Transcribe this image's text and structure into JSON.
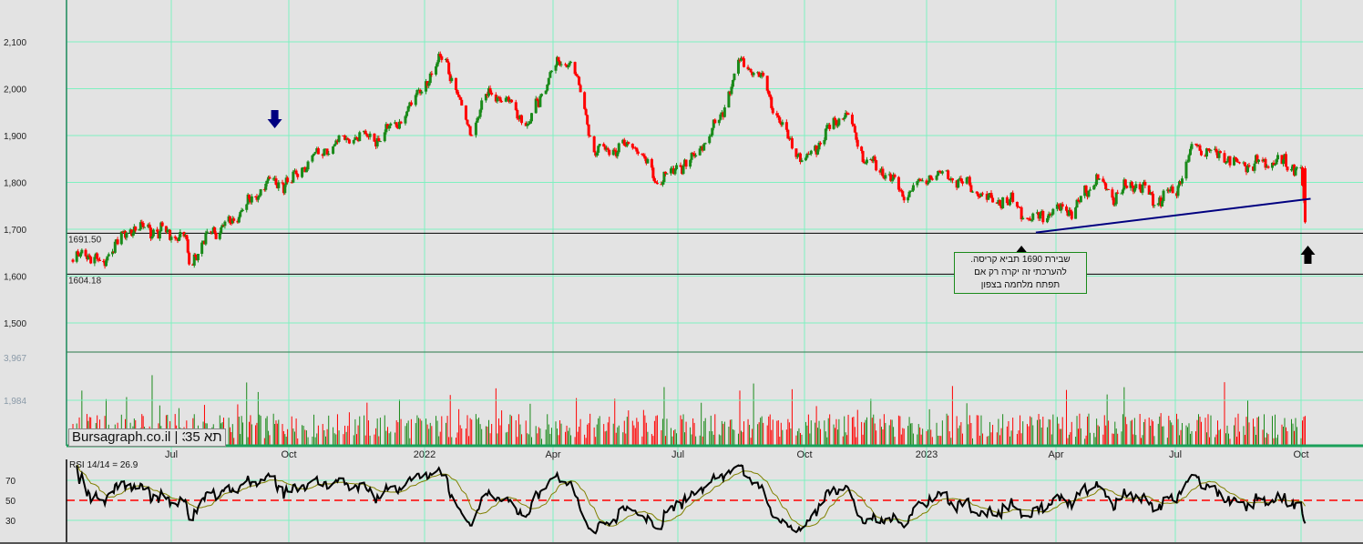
{
  "chart_data": {
    "type": "candlestick",
    "instrument": "תא 35",
    "watermark": "Bursagraph.co.il | 35 תא",
    "y_ticks": [
      "2,100",
      "2,000",
      "1,900",
      "1,800",
      "1,700",
      "1,600",
      "1,500"
    ],
    "y_tick_values": [
      2100,
      2000,
      1900,
      1800,
      1700,
      1600,
      1500
    ],
    "ylim": [
      1430,
      2190
    ],
    "x_ticks": [
      {
        "label": "Jul",
        "date": "2021-07-01"
      },
      {
        "label": "Oct",
        "date": "2021-10-01"
      },
      {
        "label": "2022",
        "date": "2022-01-01"
      },
      {
        "label": "Apr",
        "date": "2022-04-01"
      },
      {
        "label": "Jul",
        "date": "2022-07-01"
      },
      {
        "label": "Oct",
        "date": "2022-10-01"
      },
      {
        "label": "2023",
        "date": "2023-01-01"
      },
      {
        "label": "Apr",
        "date": "2023-04-01"
      },
      {
        "label": "Jul",
        "date": "2023-07-01"
      },
      {
        "label": "Oct",
        "date": "2023-10-01"
      }
    ],
    "grid": true,
    "colors": {
      "up": "#1a8a1a",
      "down": "#ff0000",
      "grid": "#7ff0c0",
      "trendline": "#000080",
      "rsi": "#000000",
      "rsi_signal": "#808000",
      "rsi_mid": "#ff0000"
    },
    "closes": [
      {
        "date": "2021-04-15",
        "close": 1635
      },
      {
        "date": "2021-05-01",
        "close": 1650
      },
      {
        "date": "2021-05-08",
        "close": 1612
      },
      {
        "date": "2021-05-15",
        "close": 1660
      },
      {
        "date": "2021-06-01",
        "close": 1705
      },
      {
        "date": "2021-06-15",
        "close": 1698
      },
      {
        "date": "2021-07-01",
        "close": 1690
      },
      {
        "date": "2021-07-12",
        "close": 1680
      },
      {
        "date": "2021-07-15",
        "close": 1625
      },
      {
        "date": "2021-08-01",
        "close": 1695
      },
      {
        "date": "2021-08-15",
        "close": 1710
      },
      {
        "date": "2021-09-01",
        "close": 1760
      },
      {
        "date": "2021-09-15",
        "close": 1800
      },
      {
        "date": "2021-10-01",
        "close": 1795
      },
      {
        "date": "2021-10-15",
        "close": 1850
      },
      {
        "date": "2021-11-01",
        "close": 1885
      },
      {
        "date": "2021-11-15",
        "close": 1900
      },
      {
        "date": "2021-12-01",
        "close": 1895
      },
      {
        "date": "2021-12-15",
        "close": 1930
      },
      {
        "date": "2022-01-01",
        "close": 2010
      },
      {
        "date": "2022-01-15",
        "close": 2070
      },
      {
        "date": "2022-02-01",
        "close": 1910
      },
      {
        "date": "2022-02-15",
        "close": 1990
      },
      {
        "date": "2022-03-01",
        "close": 1970
      },
      {
        "date": "2022-03-15",
        "close": 1920
      },
      {
        "date": "2022-04-01",
        "close": 2050
      },
      {
        "date": "2022-04-15",
        "close": 2060
      },
      {
        "date": "2022-05-01",
        "close": 1870
      },
      {
        "date": "2022-05-15",
        "close": 1870
      },
      {
        "date": "2022-06-01",
        "close": 1880
      },
      {
        "date": "2022-06-15",
        "close": 1800
      },
      {
        "date": "2022-07-01",
        "close": 1830
      },
      {
        "date": "2022-07-15",
        "close": 1860
      },
      {
        "date": "2022-08-01",
        "close": 1940
      },
      {
        "date": "2022-08-15",
        "close": 2060
      },
      {
        "date": "2022-09-01",
        "close": 2020
      },
      {
        "date": "2022-09-15",
        "close": 1910
      },
      {
        "date": "2022-10-01",
        "close": 1840
      },
      {
        "date": "2022-10-15",
        "close": 1900
      },
      {
        "date": "2022-11-01",
        "close": 1950
      },
      {
        "date": "2022-11-15",
        "close": 1850
      },
      {
        "date": "2022-12-01",
        "close": 1820
      },
      {
        "date": "2022-12-15",
        "close": 1770
      },
      {
        "date": "2023-01-01",
        "close": 1810
      },
      {
        "date": "2023-01-15",
        "close": 1820
      },
      {
        "date": "2023-02-01",
        "close": 1790
      },
      {
        "date": "2023-02-15",
        "close": 1760
      },
      {
        "date": "2023-03-01",
        "close": 1760
      },
      {
        "date": "2023-03-15",
        "close": 1720
      },
      {
        "date": "2023-04-01",
        "close": 1740
      },
      {
        "date": "2023-04-15",
        "close": 1740
      },
      {
        "date": "2023-05-01",
        "close": 1810
      },
      {
        "date": "2023-05-15",
        "close": 1770
      },
      {
        "date": "2023-06-01",
        "close": 1800
      },
      {
        "date": "2023-06-15",
        "close": 1760
      },
      {
        "date": "2023-07-01",
        "close": 1780
      },
      {
        "date": "2023-07-15",
        "close": 1880
      },
      {
        "date": "2023-08-01",
        "close": 1860
      },
      {
        "date": "2023-08-15",
        "close": 1840
      },
      {
        "date": "2023-09-01",
        "close": 1840
      },
      {
        "date": "2023-09-15",
        "close": 1845
      },
      {
        "date": "2023-10-01",
        "close": 1830
      },
      {
        "date": "2023-10-04",
        "close": 1715
      }
    ],
    "levels": [
      {
        "label": "1691.50",
        "value": 1691.5
      },
      {
        "label": "1604.18",
        "value": 1604.18
      }
    ],
    "trendline": {
      "from": {
        "date": "2023-03-18",
        "value": 1693
      },
      "to": {
        "date": "2023-10-08",
        "value": 1765
      }
    },
    "arrows": [
      {
        "dir": "down",
        "color": "#000080",
        "date": "2021-09-20",
        "value": 1935
      },
      {
        "dir": "up",
        "color": "#000000",
        "date": "2023-03-08",
        "value": 1665
      },
      {
        "dir": "up",
        "color": "#000000",
        "date": "2023-10-06",
        "value": 1665
      }
    ],
    "annotation": {
      "lines": [
        "שבירת 1690 תביא קריסה.",
        "להערכתי זה יקרה רק אם",
        "תפתח מלחמה בצפון"
      ]
    },
    "volume": {
      "ticks": [
        "3,967",
        "1,984"
      ],
      "tick_values": [
        3967,
        1984
      ]
    },
    "rsi": {
      "label": "RSI 14/14 = 26.9",
      "period": 14,
      "signal": 14,
      "value": 26.9,
      "ticks": [
        "70",
        "50",
        "30"
      ],
      "tick_values": [
        70,
        50,
        30
      ]
    }
  }
}
